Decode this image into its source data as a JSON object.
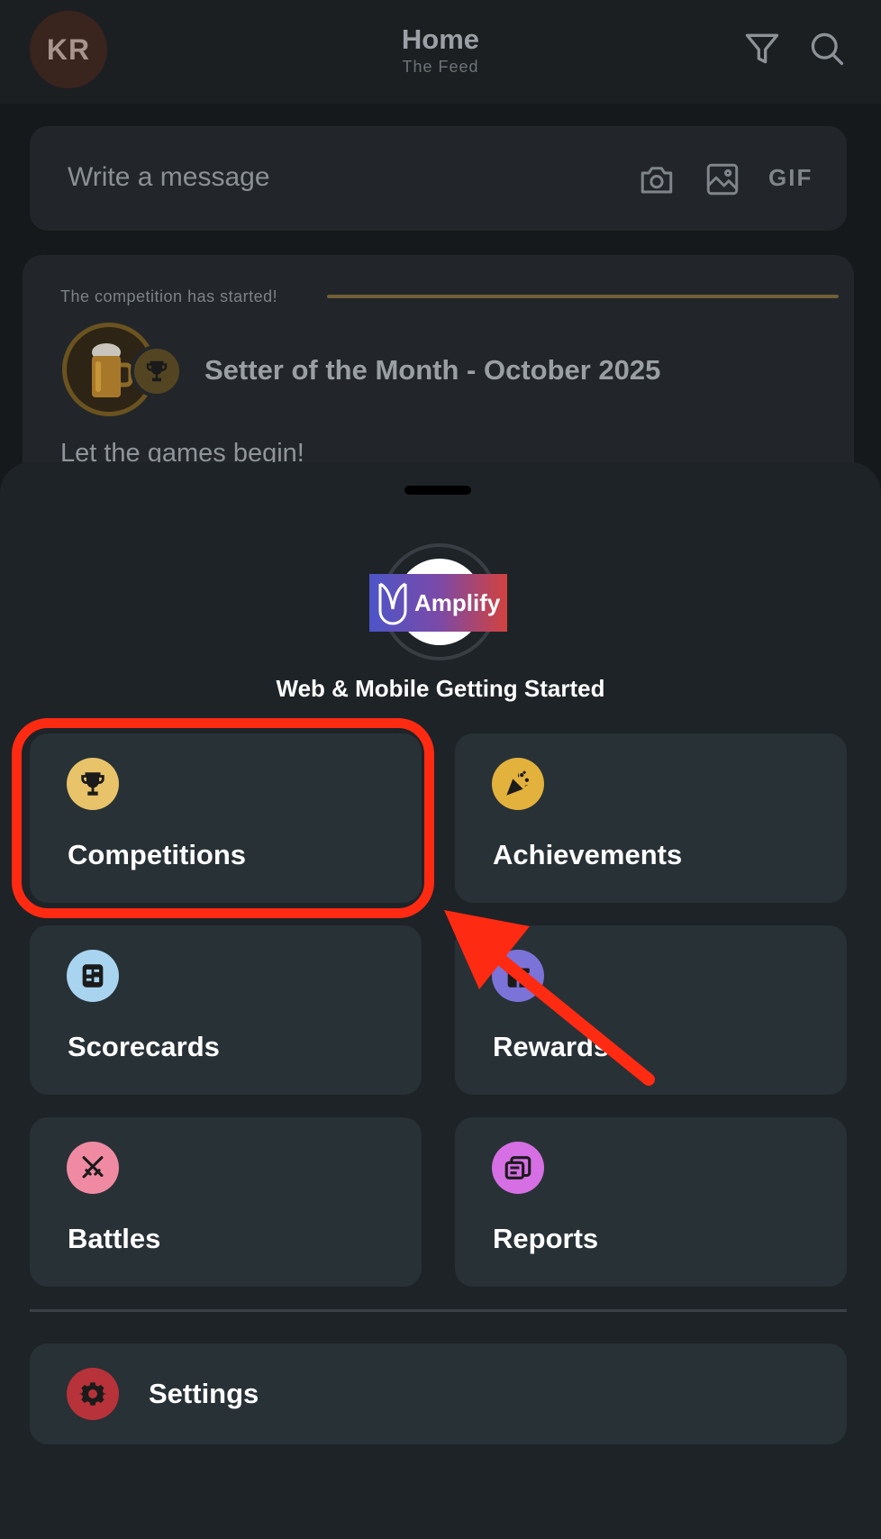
{
  "header": {
    "avatar_initials": "KR",
    "title": "Home",
    "subtitle": "The Feed",
    "icons": [
      "filter-icon",
      "search-icon"
    ]
  },
  "composer": {
    "placeholder": "Write a message",
    "gif_label": "GIF",
    "icons": [
      "camera-icon",
      "image-icon"
    ]
  },
  "feed_card": {
    "status": "The competition has started!",
    "competition_name": "Setter of the Month - October 2025",
    "message": "Let the games begin!",
    "accent_color": "#6e5f35"
  },
  "sheet": {
    "logo_text": "Amplify",
    "program_name": "Web & Mobile Getting Started",
    "tiles": [
      {
        "label": "Competitions",
        "icon": "trophy-icon",
        "color": "#e8c36a"
      },
      {
        "label": "Achievements",
        "icon": "party-popper-icon",
        "color": "#e3b23c"
      },
      {
        "label": "Scorecards",
        "icon": "scorecard-icon",
        "color": "#a8d4ef"
      },
      {
        "label": "Rewards",
        "icon": "gift-icon",
        "color": "#7c73d8"
      },
      {
        "label": "Battles",
        "icon": "crossed-swords-icon",
        "color": "#f08aa3"
      },
      {
        "label": "Reports",
        "icon": "reports-icon",
        "color": "#d66fe3"
      }
    ],
    "settings_label": "Settings",
    "settings_color": "#b8323a"
  },
  "annotation": {
    "highlight_color": "#ff2a12",
    "highlighted_tile": "Competitions"
  }
}
